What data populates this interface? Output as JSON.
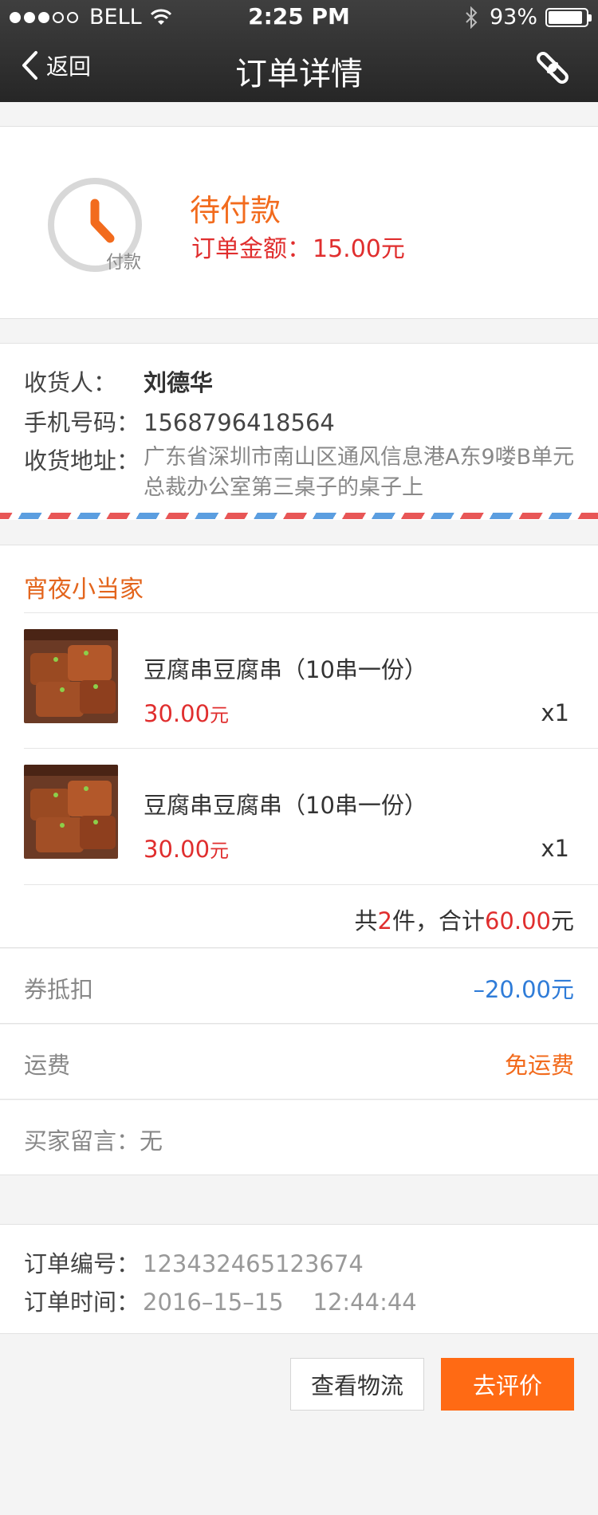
{
  "status_bar": {
    "carrier": "BELL",
    "time": "2:25 PM",
    "battery": "93%"
  },
  "nav": {
    "back_label": "返回",
    "title": "订单详情"
  },
  "order_status": {
    "state": "待付款",
    "clock_label": "付款",
    "amount_label": "订单金额：",
    "amount_value": "15.00元"
  },
  "address": {
    "receiver_label": "收货人：",
    "receiver": "刘德华",
    "phone_label": "手机号码：",
    "phone": "1568796418564",
    "address_label": "收货地址：",
    "address": "广东省深圳市南山区通风信息港A东9喽B单元总裁办公室第三桌子的桌子上"
  },
  "shop": {
    "name": "宵夜小当家",
    "items": [
      {
        "name": "豆腐串豆腐串（10串一份）",
        "price": "30.00",
        "unit": "元",
        "qty": "x1"
      },
      {
        "name": "豆腐串豆腐串（10串一份）",
        "price": "30.00",
        "unit": "元",
        "qty": "x1"
      }
    ],
    "summary": {
      "prefix": "共",
      "count": "2",
      "mid": "件，合计",
      "total": "60.00",
      "suffix": "元"
    }
  },
  "rows": {
    "coupon_label": "券抵扣",
    "coupon_value": "–20.00元",
    "shipping_label": "运费",
    "shipping_value": "免运费",
    "message_label": "买家留言：",
    "message_value": "无"
  },
  "order_info": {
    "number_label": "订单编号：",
    "number": "123432465123674",
    "time_label": "订单时间：",
    "time": "2016–15–15    12:44:44"
  },
  "buttons": {
    "logistics": "查看物流",
    "review": "去评价"
  },
  "colors": {
    "accent_orange": "#f26b1d",
    "price_red": "#e02e2e",
    "discount_blue": "#2f7cd8",
    "button_orange": "#ff6a14"
  }
}
